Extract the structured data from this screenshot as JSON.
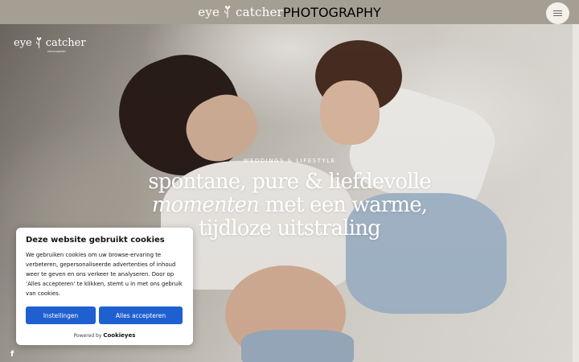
{
  "header": {
    "brand_left": "eye",
    "brand_right": "catcher",
    "brand_sub": "PHOTOGRAPHY",
    "menu_icon": "hamburger-icon"
  },
  "hero": {
    "brand_left": "eye",
    "brand_right": "catcher",
    "brand_sub": "PHOTOGRAPHY",
    "kicker": "WEDDINGS & LIFESTYLE",
    "headline_line1": "spontane, pure & liefdevolle",
    "headline_em": "momenten",
    "headline_line2_rest": " met een warme,",
    "headline_line3": "tijdloze uitstraling"
  },
  "social": {
    "facebook": "f",
    "facebook_icon": "facebook-icon"
  },
  "cookie": {
    "title": "Deze website gebruikt cookies",
    "body": "We gebruiken cookies om uw browse-ervaring te verbeteren, gepersonaliseerde advertenties of inhoud weer te geven en ons verkeer te analyseren. Door op ‘Alles accepteren’ te klikken, stemt u in met ons gebruik van cookies.",
    "settings_label": "Instellingen",
    "accept_label": "Alles accepteren",
    "powered_by": "Powered by",
    "powered_brand": "Cookieyes",
    "accent": "#1f60d1"
  }
}
